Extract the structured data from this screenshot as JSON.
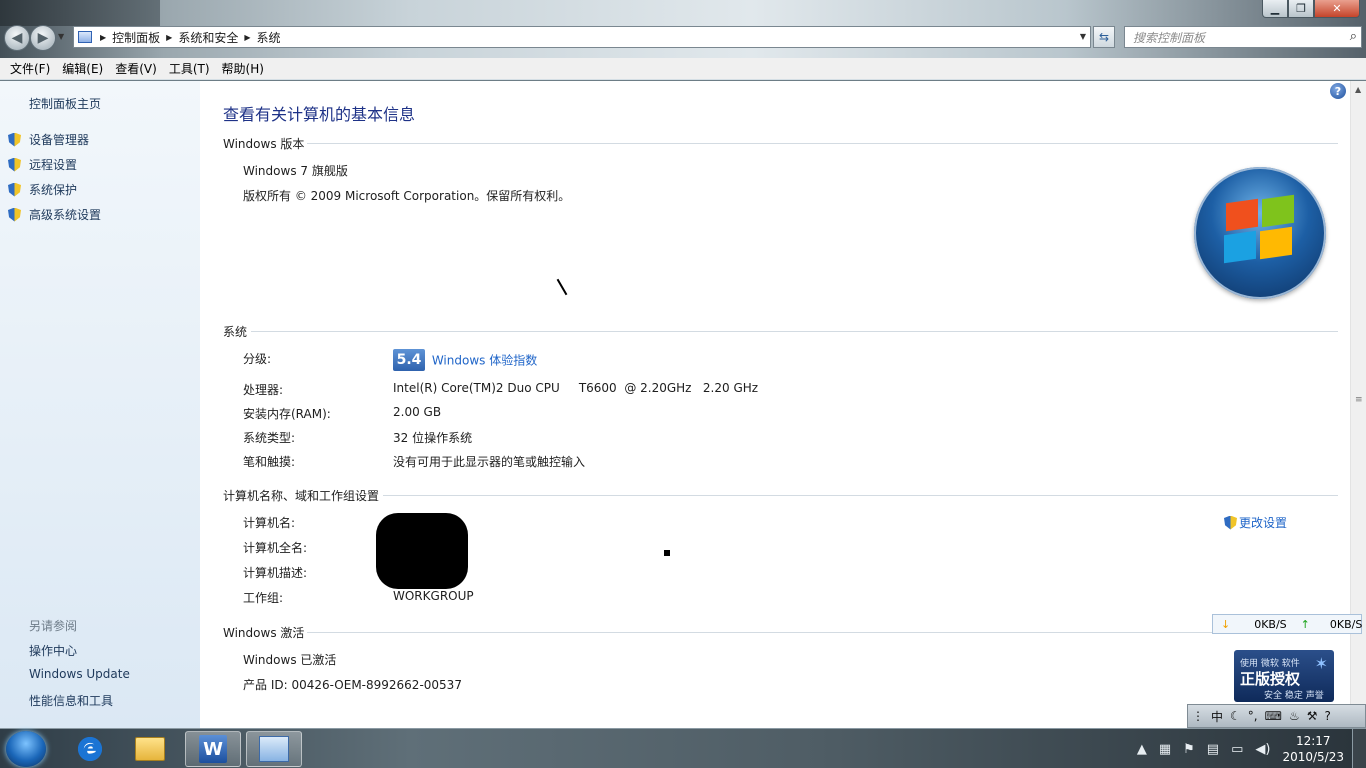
{
  "window": {
    "breadcrumbs": [
      "控制面板",
      "系统和安全",
      "系统"
    ],
    "search_placeholder": "搜索控制面板"
  },
  "menubar": [
    "文件(F)",
    "编辑(E)",
    "查看(V)",
    "工具(T)",
    "帮助(H)"
  ],
  "left_pane": {
    "home": "控制面板主页",
    "tasks": [
      "设备管理器",
      "远程设置",
      "系统保护",
      "高级系统设置"
    ],
    "see_also_label": "另请参阅",
    "see_also": [
      "操作中心",
      "Windows Update",
      "性能信息和工具"
    ]
  },
  "main": {
    "title": "查看有关计算机的基本信息",
    "edition": {
      "header": "Windows 版本",
      "name": "Windows 7 旗舰版",
      "copyright": "版权所有 © 2009 Microsoft Corporation。保留所有权利。"
    },
    "system": {
      "header": "系统",
      "rating_label": "分级:",
      "rating_score": "5.4",
      "rating_link": "Windows 体验指数",
      "processor_label": "处理器:",
      "processor_value": "Intel(R) Core(TM)2 Duo CPU     T6600  @ 2.20GHz   2.20 GHz",
      "ram_label": "安装内存(RAM):",
      "ram_value": "2.00 GB",
      "type_label": "系统类型:",
      "type_value": "32 位操作系统",
      "pen_label": "笔和触摸:",
      "pen_value": "没有可用于此显示器的笔或触控输入"
    },
    "computer": {
      "header": "计算机名称、域和工作组设置",
      "name_label": "计算机名:",
      "fullname_label": "计算机全名:",
      "desc_label": "计算机描述:",
      "workgroup_label": "工作组:",
      "workgroup_value": "WORKGROUP",
      "change_settings": "更改设置"
    },
    "activation": {
      "header": "Windows 激活",
      "status": "Windows 已激活",
      "product_id": "产品 ID: 00426-OEM-8992662-00537"
    }
  },
  "netspeed": {
    "down": "0KB/S",
    "up": "0KB/S"
  },
  "genuine_badge": {
    "line1": "使用 微软 软件",
    "line2": "正版授权",
    "line3": "安全 稳定 声誉"
  },
  "ime_bar": {
    "mode": "中"
  },
  "clock": {
    "time": "12:17",
    "date": "2010/5/23"
  }
}
